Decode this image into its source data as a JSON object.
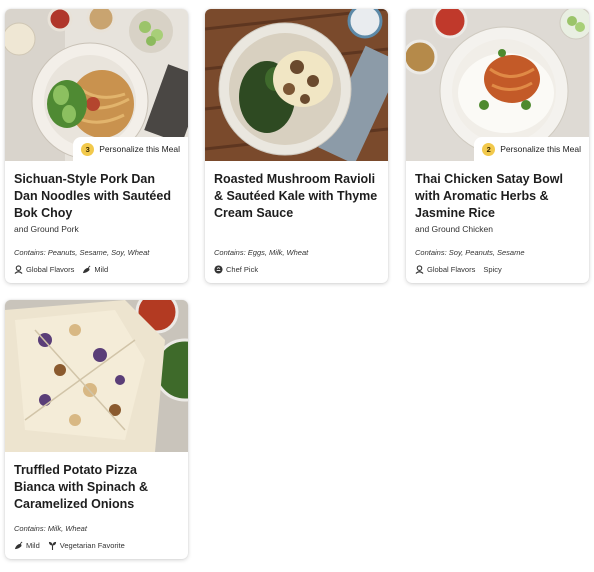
{
  "cards": [
    {
      "title": "Sichuan-Style Pork Dan Dan Noodles with Sautéed Bok Choy",
      "subtitle": "and Ground Pork",
      "contains": "Contains: Peanuts, Sesame, Soy, Wheat",
      "personalize": {
        "count": "3",
        "label": "Personalize this Meal"
      },
      "tags": [
        {
          "label": "Global Flavors",
          "icon": "globe-person-icon"
        },
        {
          "label": "Mild",
          "icon": "chili-pepper-icon"
        }
      ]
    },
    {
      "title": "Roasted Mushroom Ravioli & Sautéed Kale with Thyme Cream Sauce",
      "subtitle": "",
      "contains": "Contains: Eggs, Milk, Wheat",
      "tags": [
        {
          "label": "Chef Pick",
          "icon": "chef-badge-icon"
        }
      ]
    },
    {
      "title": "Thai Chicken Satay Bowl with Aromatic Herbs & Jasmine Rice",
      "subtitle": "and Ground Chicken",
      "contains": "Contains: Soy, Peanuts, Sesame",
      "personalize": {
        "count": "2",
        "label": "Personalize this Meal"
      },
      "tags": [
        {
          "label": "Global Flavors",
          "icon": "globe-person-icon"
        },
        {
          "label": "Spicy",
          "icon": ""
        }
      ]
    },
    {
      "title": "Truffled Potato Pizza Bianca with Spinach & Caramelized Onions",
      "subtitle": "",
      "contains": "Contains: Milk, Wheat",
      "tags": [
        {
          "label": "Mild",
          "icon": "chili-pepper-icon"
        },
        {
          "label": "Vegetarian Favorite",
          "icon": "sprout-icon"
        }
      ]
    }
  ],
  "colors": {
    "badge": "#f2c94c",
    "text": "#1e1e1e"
  }
}
